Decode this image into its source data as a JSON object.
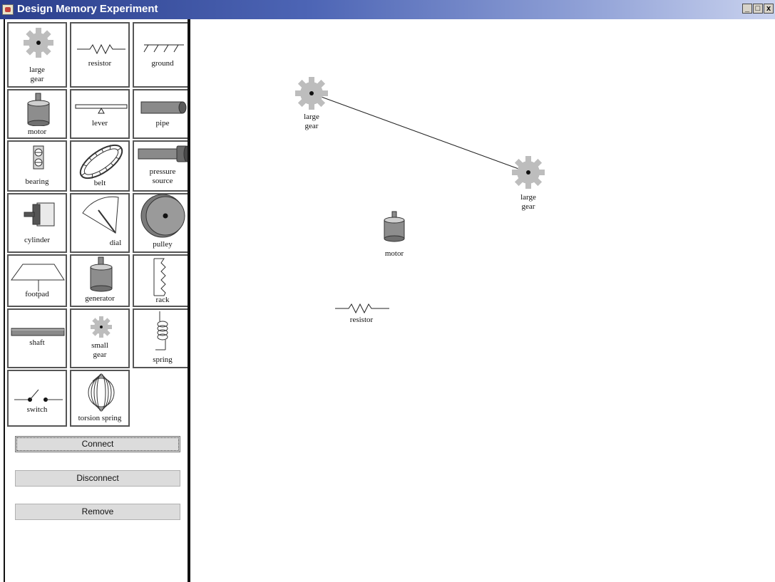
{
  "window": {
    "title": "Design Memory Experiment",
    "controls": {
      "minimize": "_",
      "maximize": "□",
      "close": "x"
    }
  },
  "palette": [
    {
      "label": "large\ngear",
      "icon": "large-gear-icon"
    },
    {
      "label": "resistor",
      "icon": "resistor-icon"
    },
    {
      "label": "ground",
      "icon": "ground-icon"
    },
    {
      "label": "motor",
      "icon": "motor-icon"
    },
    {
      "label": "lever",
      "icon": "lever-icon"
    },
    {
      "label": "pipe",
      "icon": "pipe-icon"
    },
    {
      "label": "bearing",
      "icon": "bearing-icon"
    },
    {
      "label": "belt",
      "icon": "belt-icon"
    },
    {
      "label": "pressure\nsource",
      "icon": "pressure-source-icon"
    },
    {
      "label": "cylinder",
      "icon": "cylinder-icon"
    },
    {
      "label": "dial",
      "icon": "dial-icon"
    },
    {
      "label": "pulley",
      "icon": "pulley-icon"
    },
    {
      "label": "footpad",
      "icon": "footpad-icon"
    },
    {
      "label": "generator",
      "icon": "generator-icon"
    },
    {
      "label": "rack",
      "icon": "rack-icon"
    },
    {
      "label": "shaft",
      "icon": "shaft-icon"
    },
    {
      "label": "small\ngear",
      "icon": "small-gear-icon"
    },
    {
      "label": "spring",
      "icon": "spring-icon"
    },
    {
      "label": "switch",
      "icon": "switch-icon"
    },
    {
      "label": "torsion spring",
      "icon": "torsion-spring-icon"
    }
  ],
  "buttons": {
    "connect": "Connect",
    "disconnect": "Disconnect",
    "remove": "Remove"
  },
  "canvas": {
    "components": [
      {
        "label": "large\ngear",
        "icon": "large-gear-icon"
      },
      {
        "label": "large\ngear",
        "icon": "large-gear-icon"
      },
      {
        "label": "motor",
        "icon": "motor-icon"
      },
      {
        "label": "resistor",
        "icon": "resistor-icon"
      }
    ],
    "connections": [
      {
        "from": 0,
        "to": 1
      }
    ]
  }
}
